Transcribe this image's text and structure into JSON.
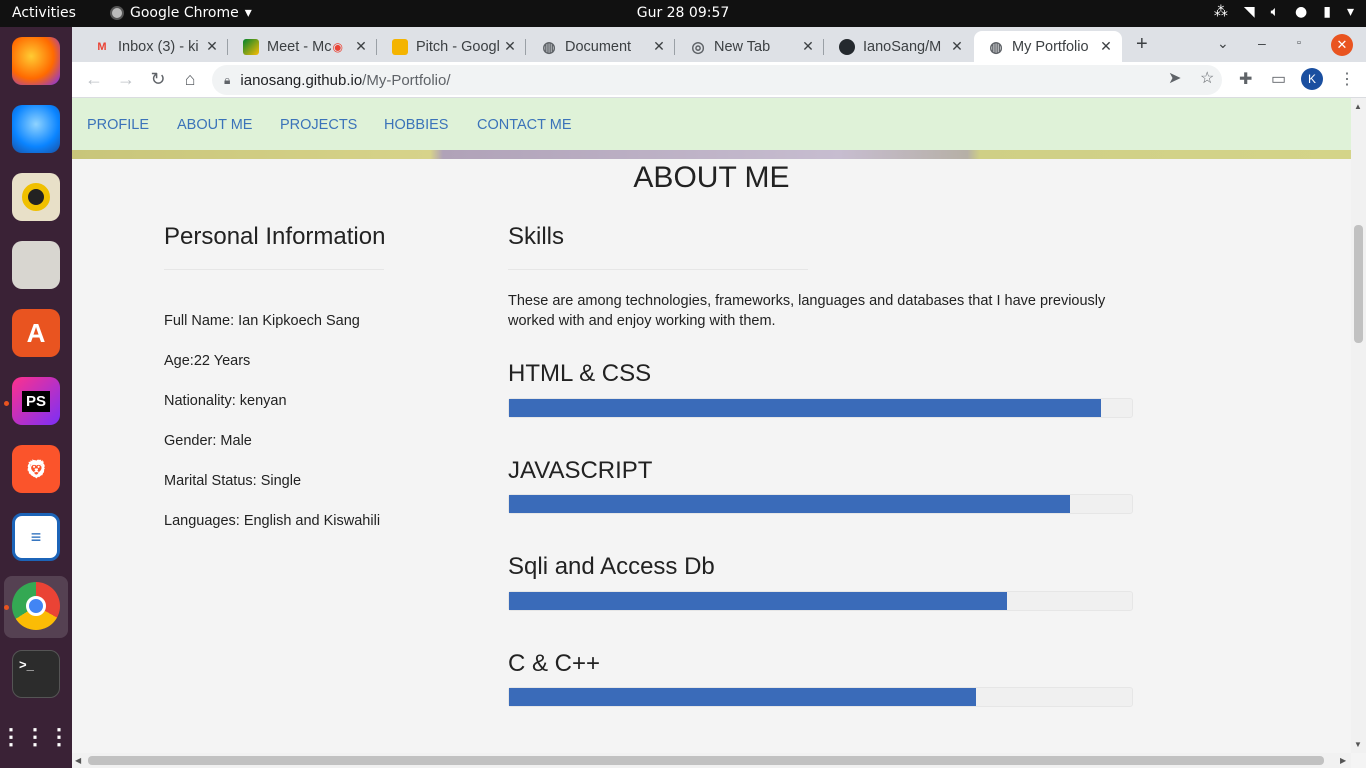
{
  "system": {
    "activities": "Activities",
    "app_name": "Google Chrome",
    "clock": "Gur 28  09:57"
  },
  "dock": {
    "apps": [
      "Firefox",
      "Thunderbird",
      "Rhythmbox",
      "Files",
      "Ubuntu Software",
      "PhpStorm",
      "Brave",
      "LibreOffice Writer",
      "Google Chrome",
      "Terminal",
      "Show Applications"
    ],
    "terminal_prompt": ">_"
  },
  "browser": {
    "tabs": [
      {
        "title": "Inbox (3) - ki",
        "icon": "gmail-icon"
      },
      {
        "title": "Meet - Mc",
        "icon": "meet-icon"
      },
      {
        "title": "Pitch - Googl",
        "icon": "slides-icon"
      },
      {
        "title": "Document",
        "icon": "globe-icon"
      },
      {
        "title": "New Tab",
        "icon": "chrome-icon"
      },
      {
        "title": "IanoSang/M",
        "icon": "github-icon"
      },
      {
        "title": "My Portfolio",
        "icon": "globe-icon",
        "active": true
      }
    ],
    "url_host": "ianosang.github.io",
    "url_path": "/My-Portfolio/",
    "profile_initial": "K"
  },
  "page": {
    "nav": [
      "PROFILE",
      "ABOUT ME",
      "PROJECTS",
      "HOBBIES",
      "CONTACT ME"
    ],
    "about_title": "ABOUT ME",
    "personal": {
      "title": "Personal Information",
      "items": [
        "Full Name: Ian Kipkoech Sang",
        "Age:22 Years",
        "Nationality: kenyan",
        "Gender: Male",
        "Marital Status: Single",
        "Languages: English and Kiswahili"
      ]
    },
    "skills": {
      "title": "Skills",
      "intro": "These are among technologies, frameworks, languages and databases that I have previously worked with and enjoy working with them.",
      "list": [
        {
          "name": "HTML & CSS",
          "level_percent": 95
        },
        {
          "name": "JAVASCRIPT",
          "level_percent": 90
        },
        {
          "name": "Sqli and Access Db",
          "level_percent": 80
        },
        {
          "name": "C & C++",
          "level_percent": 75
        }
      ]
    }
  },
  "colors": {
    "nav_bg": "#dff2d8",
    "nav_link": "#3b73b9",
    "skill_bar": "#3a6bb9",
    "dock_bg": "#3a2236",
    "accent": "#e95420"
  }
}
